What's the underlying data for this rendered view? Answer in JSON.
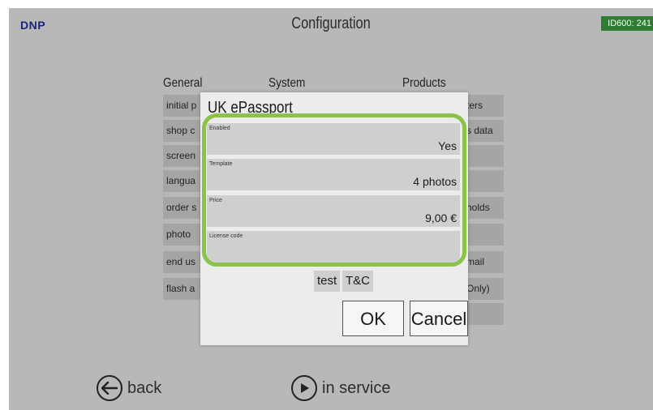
{
  "header": {
    "logo": "DNP",
    "title": "Configuration",
    "device_id": "ID600: 241"
  },
  "columns": {
    "general": "General",
    "system": "System",
    "products": "Products"
  },
  "general_items": [
    "initial p",
    "shop c",
    "screen",
    "langua",
    "order s",
    "photo",
    "end us",
    "flash a"
  ],
  "products_items": [
    "ters",
    "s data",
    "",
    "",
    "holds",
    "",
    "mail",
    "Only)",
    ""
  ],
  "dialog": {
    "title": "UK ePassport",
    "fields": [
      {
        "label": "Enabled",
        "value": "Yes"
      },
      {
        "label": "Template",
        "value": "4 photos"
      },
      {
        "label": "Price",
        "value": "9,00 €"
      },
      {
        "label": "License code",
        "value": ""
      }
    ],
    "test_label": "test",
    "tc_label": "T&C",
    "ok_label": "OK",
    "cancel_label": "Cancel"
  },
  "footer": {
    "back_label": "back",
    "in_service_label": "in service"
  },
  "colors": {
    "highlight": "#8bc34a",
    "device_badge": "#2e7d32",
    "logo": "#1a237e"
  }
}
